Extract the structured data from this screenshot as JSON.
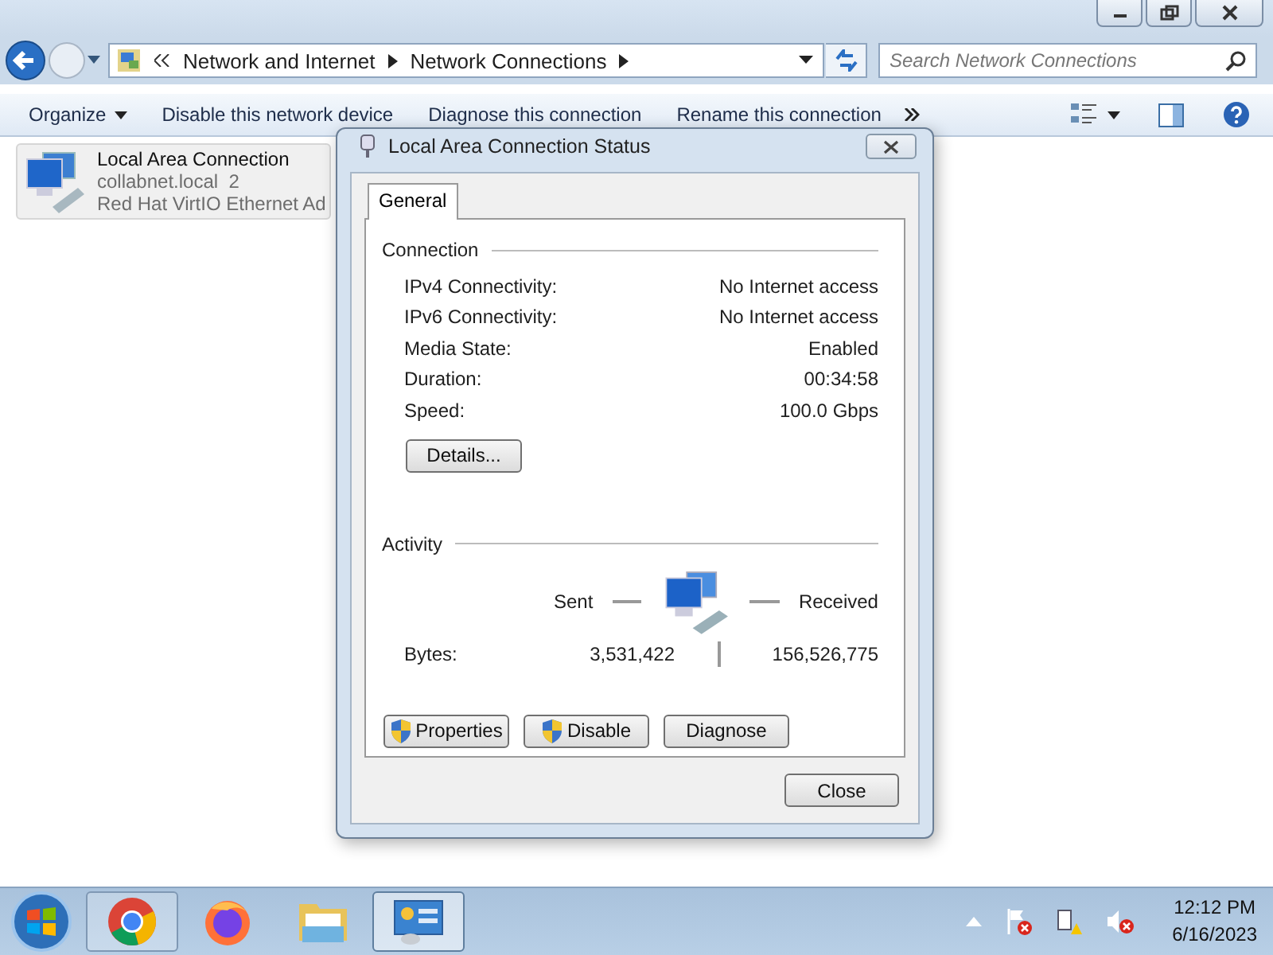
{
  "explorer": {
    "breadcrumb": [
      "Network and Internet",
      "Network Connections"
    ],
    "search": {
      "placeholder": "Search Network Connections"
    },
    "toolbar": [
      "Organize",
      "Disable this network device",
      "Diagnose this connection",
      "Rename this connection"
    ],
    "items": [
      {
        "name": "Local Area Connection",
        "network": "collabnet.local  2",
        "adapter": "Red Hat VirtIO Ethernet Ad",
        "selected": true
      }
    ]
  },
  "dialog": {
    "title": "Local Area Connection Status",
    "tabs": [
      {
        "label": "General",
        "selected": true
      }
    ],
    "connection": {
      "heading": "Connection",
      "rows": [
        {
          "label": "IPv4 Connectivity:",
          "value": "No Internet access"
        },
        {
          "label": "IPv6 Connectivity:",
          "value": "No Internet access"
        },
        {
          "label": "Media State:",
          "value": "Enabled"
        },
        {
          "label": "Duration:",
          "value": "00:34:58"
        },
        {
          "label": "Speed:",
          "value": "100.0 Gbps"
        }
      ],
      "details_button": "Details..."
    },
    "activity": {
      "heading": "Activity",
      "sent": "Sent",
      "received": "Received",
      "bytes_label": "Bytes:",
      "bytes_sent": "3,531,422",
      "bytes_received": "156,526,775"
    },
    "buttons": [
      {
        "label": "Properties",
        "shield": true
      },
      {
        "label": "Disable",
        "shield": true
      },
      {
        "label": "Diagnose",
        "shield": false
      }
    ],
    "close": "Close"
  },
  "taskbar": {
    "apps": [
      {
        "kind": "chrome",
        "running": true,
        "selected": false
      },
      {
        "kind": "firefox",
        "running": false,
        "selected": false
      },
      {
        "kind": "folder",
        "running": false,
        "selected": false
      },
      {
        "kind": "control-panel",
        "running": true,
        "selected": true
      }
    ],
    "clock": {
      "time": "12:12 PM",
      "date": "6/16/2023"
    }
  }
}
